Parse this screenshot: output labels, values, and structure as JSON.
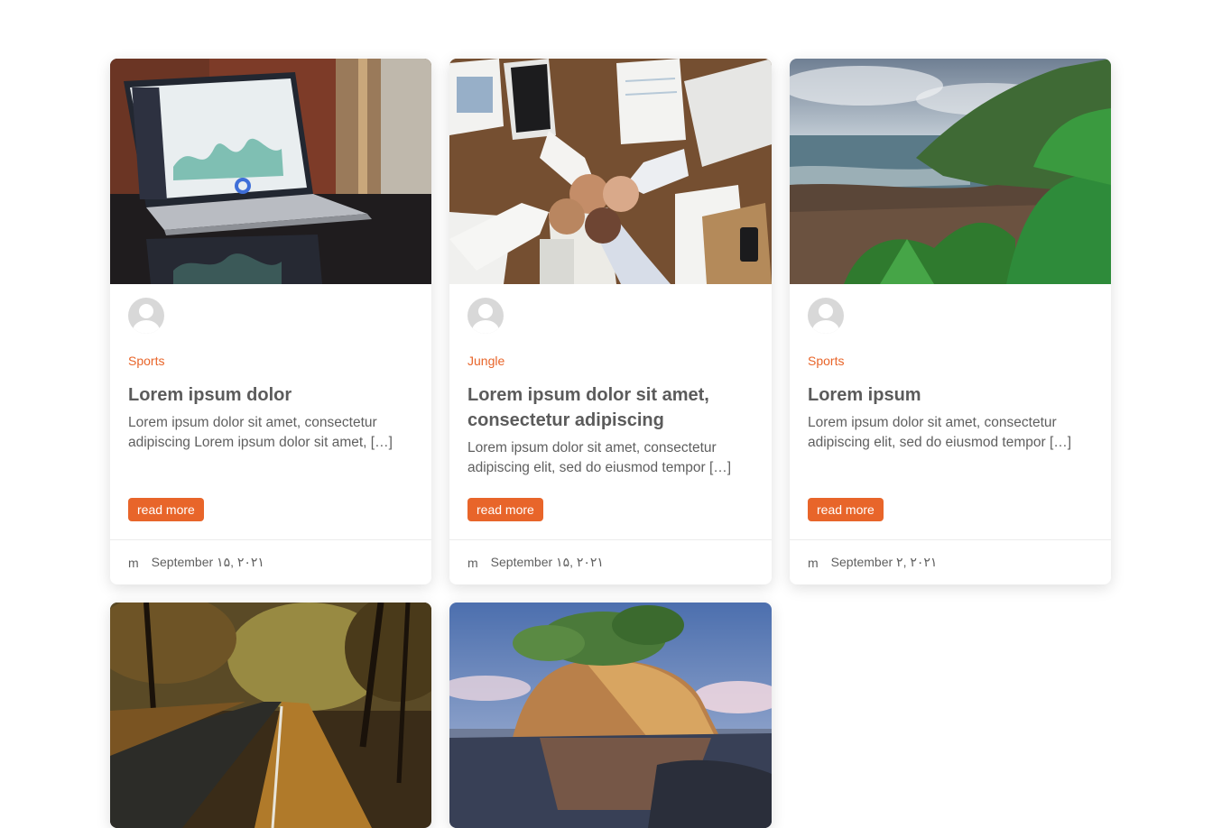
{
  "posts": [
    {
      "image": "laptop-dashboard",
      "category": "Sports",
      "title": "Lorem ipsum dolor",
      "excerpt": "Lorem ipsum dolor sit amet, consectetur adipiscing Lorem ipsum dolor sit amet, […]",
      "read_more": "read more",
      "author": "m",
      "date": "September ۱۵, ۲۰۲۱"
    },
    {
      "image": "team-fist-bump",
      "category": "Jungle",
      "title": "Lorem ipsum dolor sit amet, consectetur adipiscing",
      "excerpt": "Lorem ipsum dolor sit amet, consectetur adipiscing elit, sed do eiusmod tempor […]",
      "read_more": "read more",
      "author": "m",
      "date": "September ۱۵, ۲۰۲۱"
    },
    {
      "image": "tropical-coast",
      "category": "Sports",
      "title": "Lorem ipsum",
      "excerpt": "Lorem ipsum dolor sit amet, consectetur adipiscing elit, sed do eiusmod tempor […]",
      "read_more": "read more",
      "author": "m",
      "date": "September ۲, ۲۰۲۱"
    },
    {
      "image": "autumn-forest-road"
    },
    {
      "image": "rock-island-sunset"
    }
  ],
  "colors": {
    "accent": "#e8652a",
    "text": "#5b5b5b"
  }
}
